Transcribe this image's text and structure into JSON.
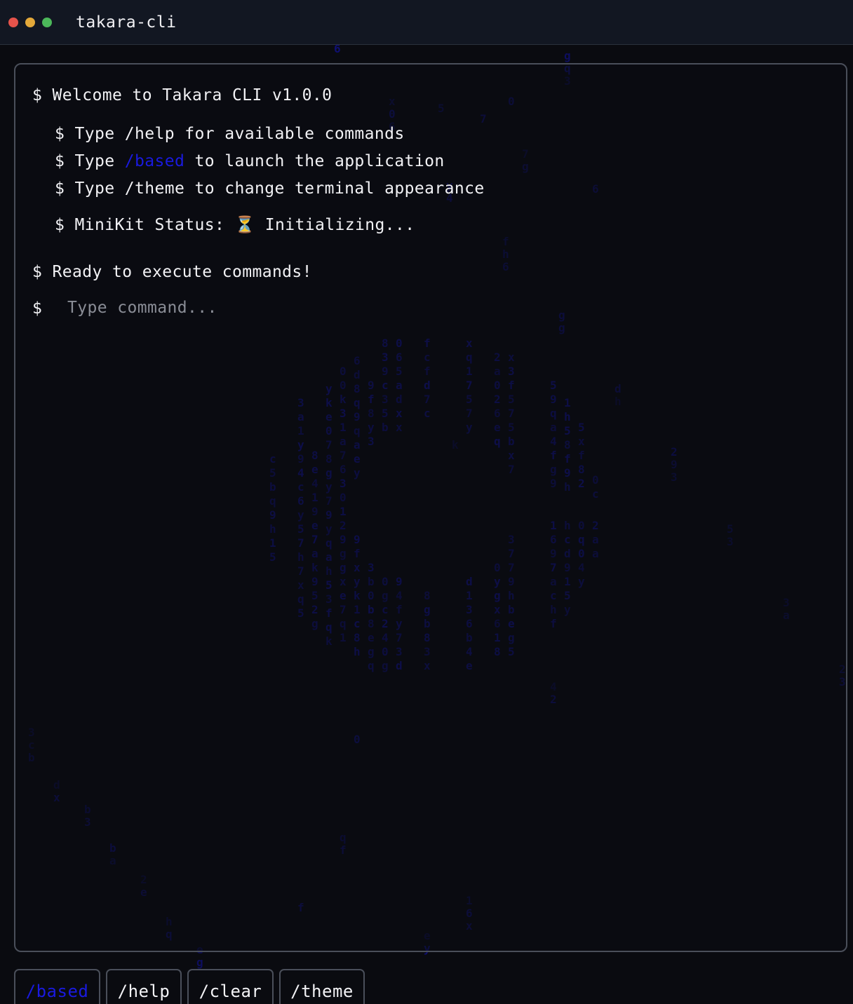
{
  "window": {
    "title": "takara-cli"
  },
  "terminal": {
    "lines": [
      {
        "prompt": "$",
        "text": "Welcome to Takara CLI v1.0.0"
      },
      {
        "prompt": "$",
        "text": "Type /help for available commands"
      },
      {
        "prompt": "$",
        "before": "Type ",
        "highlight": "/based",
        "after": " to launch the application"
      },
      {
        "prompt": "$",
        "text": "Type /theme to change terminal appearance"
      },
      {
        "prompt": "$",
        "before": "MiniKit Status: ",
        "icon": "⏳",
        "after": " Initializing..."
      },
      {
        "prompt": "$",
        "text": "Ready to execute commands!"
      }
    ],
    "input": {
      "prompt": "$",
      "placeholder": "Type command...",
      "value": ""
    }
  },
  "commands": [
    {
      "label": "/based",
      "active": true
    },
    {
      "label": "/help",
      "active": false
    },
    {
      "label": "/clear",
      "active": false
    },
    {
      "label": "/theme",
      "active": false
    }
  ],
  "colors": {
    "accent": "#1a1adf",
    "rain": "#1414c8",
    "background": "#0a0b10",
    "border": "#4a4f5a",
    "titlebar": "#121722"
  },
  "icons": {
    "status": "hourglass-icon"
  }
}
